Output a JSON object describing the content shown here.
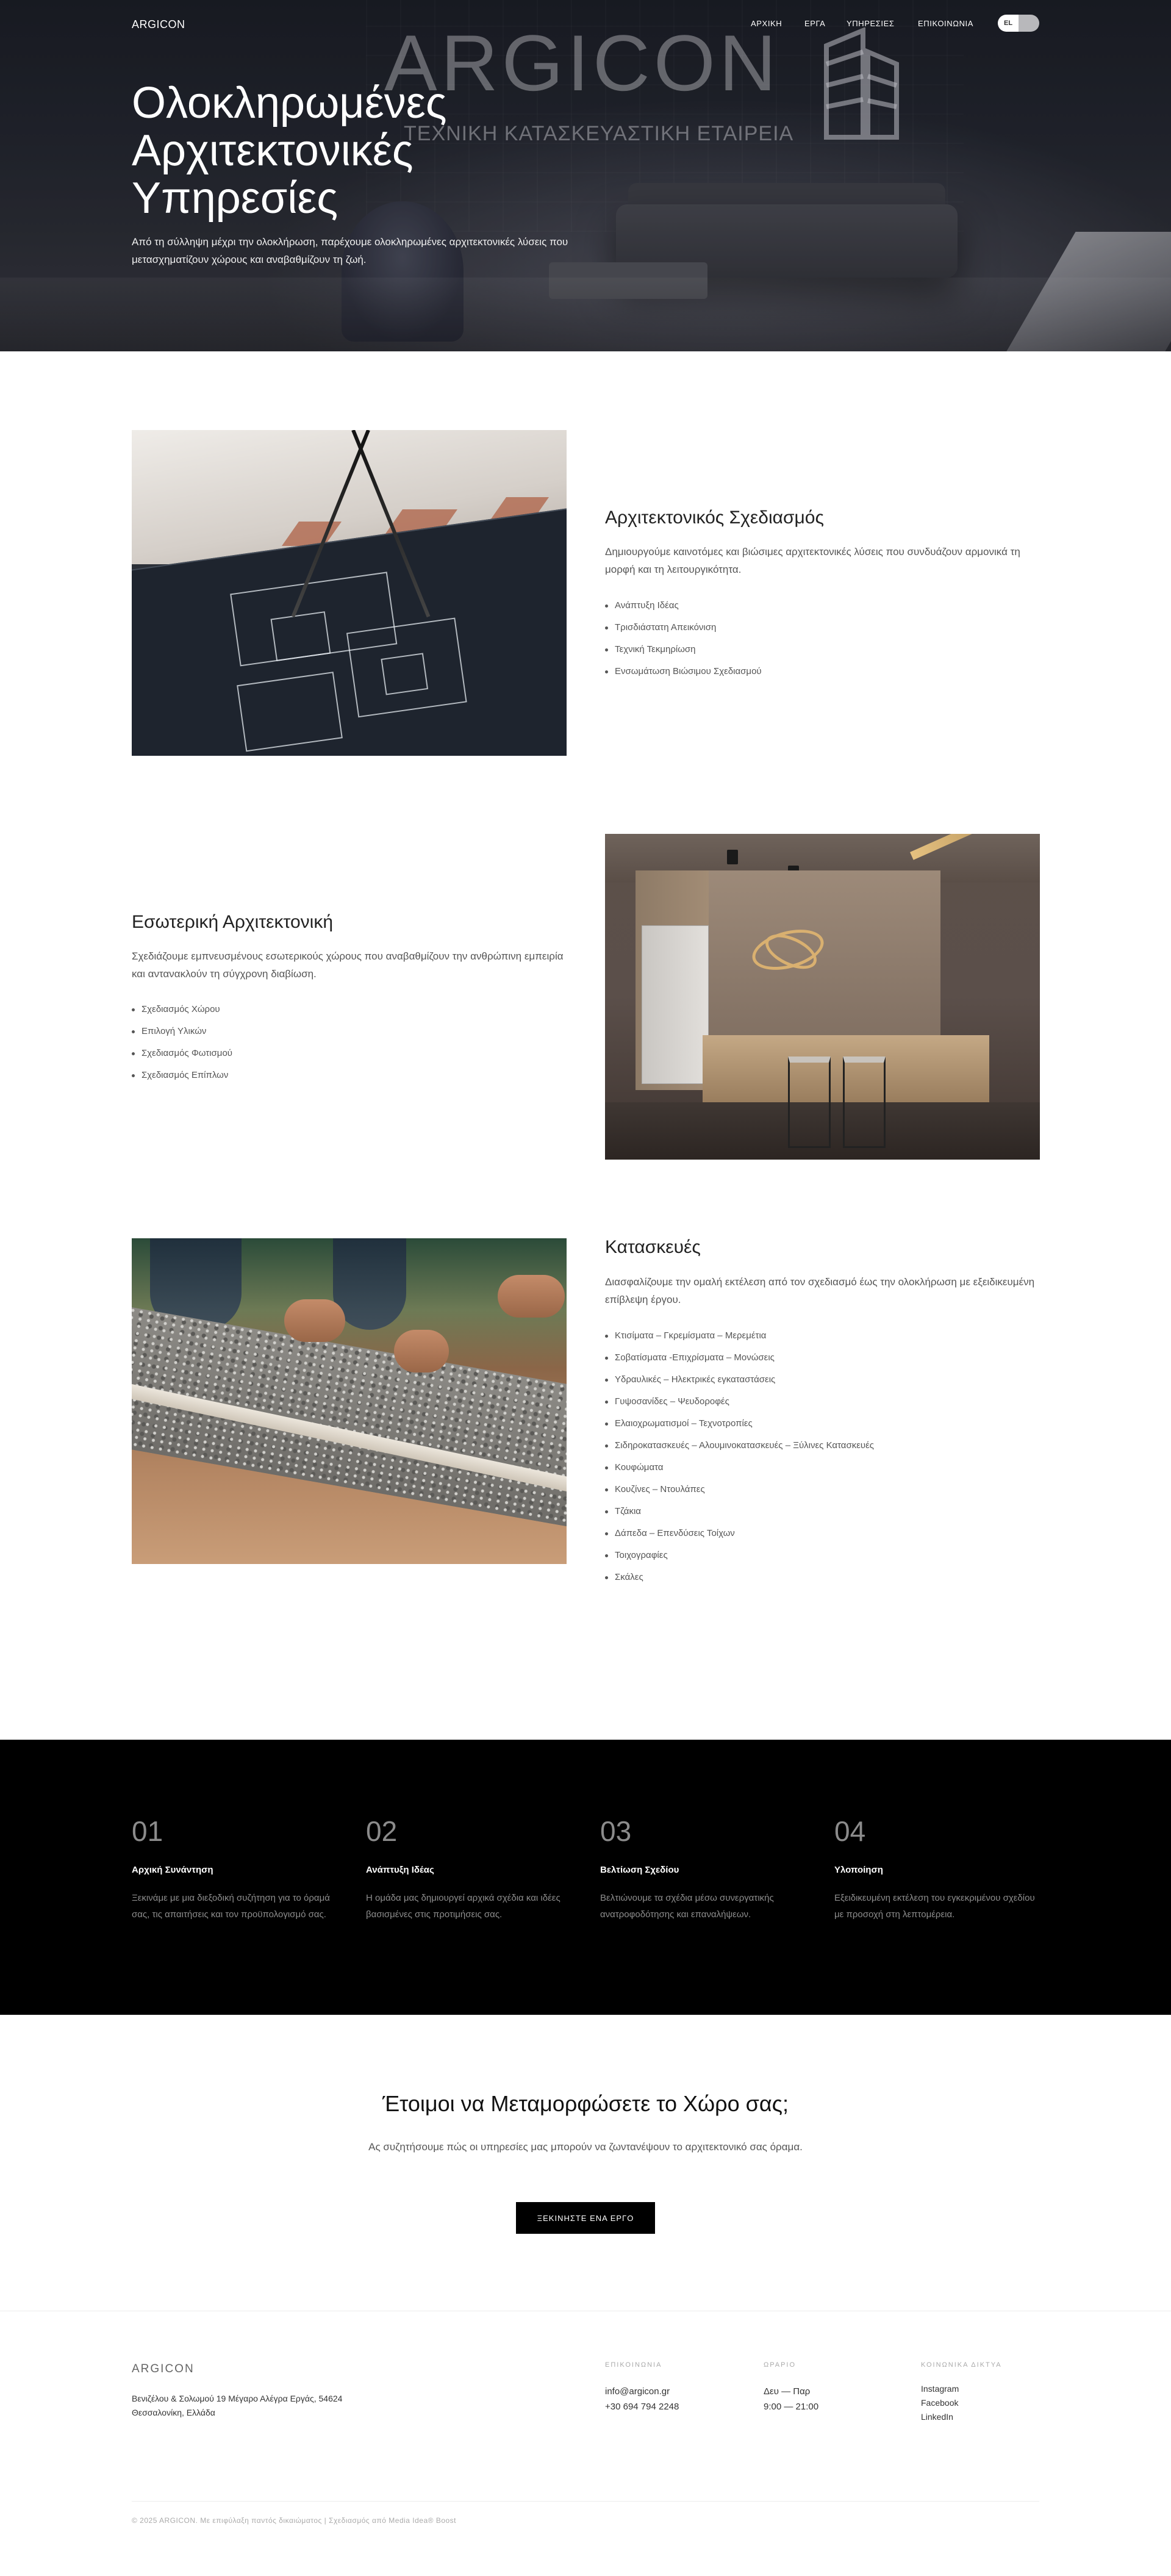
{
  "nav": {
    "logo": "ARGICON",
    "items": [
      {
        "label": "ΑΡΧΙΚΗ"
      },
      {
        "label": "ΕΡΓΑ"
      },
      {
        "label": "ΥΠΗΡΕΣΙΕΣ"
      },
      {
        "label": "ΕΠΙΚΟΙΝΩΝΙΑ"
      }
    ],
    "lang": "EL"
  },
  "hero": {
    "brand": "ARGICON",
    "brand_subtitle": "ΤΕΧΝΙΚΗ ΚΑΤΑΣΚΕΥΑΣΤΙΚΗ ΕΤΑΙΡΕΙΑ",
    "title_lines": [
      "Ολοκληρωμένες",
      "Αρχιτεκτονικές",
      "Υπηρεσίες"
    ],
    "text": "Από τη σύλληψη μέχρι την ολοκλήρωση, παρέχουμε ολοκληρωμένες αρχιτεκτονικές λύσεις που μετασχηματίζουν χώρους και αναβαθμίζουν τη ζωή."
  },
  "services": [
    {
      "title": "Αρχιτεκτονικός Σχεδιασμός",
      "description": "Δημιουργούμε καινοτόμες και βιώσιμες αρχιτεκτονικές λύσεις που συνδυάζουν αρμονικά τη μορφή και τη λειτουργικότητα.",
      "items": [
        "Ανάπτυξη Ιδέας",
        "Τρισδιάστατη Απεικόνιση",
        "Τεχνική Τεκμηρίωση",
        "Ενσωμάτωση Βιώσιμου Σχεδιασμού"
      ]
    },
    {
      "title": "Εσωτερική Αρχιτεκτονική",
      "description": "Σχεδιάζουμε εμπνευσμένους εσωτερικούς χώρους που αναβαθμίζουν την ανθρώπινη εμπειρία και αντανακλούν τη σύγχρονη διαβίωση.",
      "items": [
        "Σχεδιασμός Χώρου",
        "Επιλογή Υλικών",
        "Σχεδιασμός Φωτισμού",
        "Σχεδιασμός Επίπλων"
      ]
    },
    {
      "title": "Κατασκευές",
      "description": "Διασφαλίζουμε την ομαλή εκτέλεση από τον σχεδιασμό έως την ολοκλήρωση με εξειδικευμένη επίβλεψη έργου.",
      "items": [
        "Κτισίματα – Γκρεμίσματα – Μερεμέτια",
        "Σοβατίσματα -Επιχρίσματα – Μονώσεις",
        "Υδραυλικές – Ηλεκτρικές εγκαταστάσεις",
        "Γυψοσανίδες – Ψευδοροφές",
        "Ελαιοχρωματισμοί – Τεχνοτροπίες",
        "Σιδηροκατασκευές – Αλουμινοκατασκευές – Ξύλινες Κατασκευές",
        "Κουφώματα",
        "Κουζίνες – Ντουλάπες",
        "Τζάκια",
        "Δάπεδα – Επενδύσεις Τοίχων",
        "Τοιχογραφίες",
        "Σκάλες"
      ]
    }
  ],
  "process": [
    {
      "num": "01",
      "title": "Αρχική Συνάντηση",
      "text": "Ξεκινάμε με μια διεξοδική συζήτηση για το όραμά σας, τις απαιτήσεις και τον προϋπολογισμό σας."
    },
    {
      "num": "02",
      "title": "Ανάπτυξη Ιδέας",
      "text": "Η ομάδα μας δημιουργεί αρχικά σχέδια και ιδέες βασισμένες στις προτιμήσεις σας."
    },
    {
      "num": "03",
      "title": "Βελτίωση Σχεδίου",
      "text": "Βελτιώνουμε τα σχέδια μέσω συνεργατικής ανατροφοδότησης και επαναλήψεων."
    },
    {
      "num": "04",
      "title": "Υλοποίηση",
      "text": "Εξειδικευμένη εκτέλεση του εγκεκριμένου σχεδίου με προσοχή στη λεπτομέρεια."
    }
  ],
  "cta": {
    "title": "Έτοιμοι να Μεταμορφώσετε το Χώρο σας;",
    "text": "Ας συζητήσουμε πώς οι υπηρεσίες μας μπορούν να ζωντανέψουν το αρχιτεκτονικό σας όραμα.",
    "button": "ΞΕΚΙΝΗΣΤΕ ΕΝΑ ΕΡΓΟ"
  },
  "footer": {
    "logo": "ARGICON",
    "address_line1": "Βενιζέλου & Σολωμού 19 Μέγαρο Αλέγρα Εργάς, 54624",
    "address_line2": "Θεσσαλονίκη, Ελλάδα",
    "contact_heading": "ΕΠΙΚΟΙΝΩΝΙΑ",
    "email": "info@argicon.gr",
    "phone": "+30 694 794 2248",
    "hours_heading": "ΩΡΑΡΙΟ",
    "days": "Δευ — Παρ",
    "hours": "9:00 — 21:00",
    "social_heading": "ΚΟΙΝΩΝΙΚΑ ΔΙΚΤΥΑ",
    "social": [
      "Instagram",
      "Facebook",
      "LinkedIn"
    ],
    "copyright": "© 2025 ARGICON. Με επιφύλαξη παντός δικαιώματος | Σχεδιασμός από Media Idea® Boost"
  }
}
